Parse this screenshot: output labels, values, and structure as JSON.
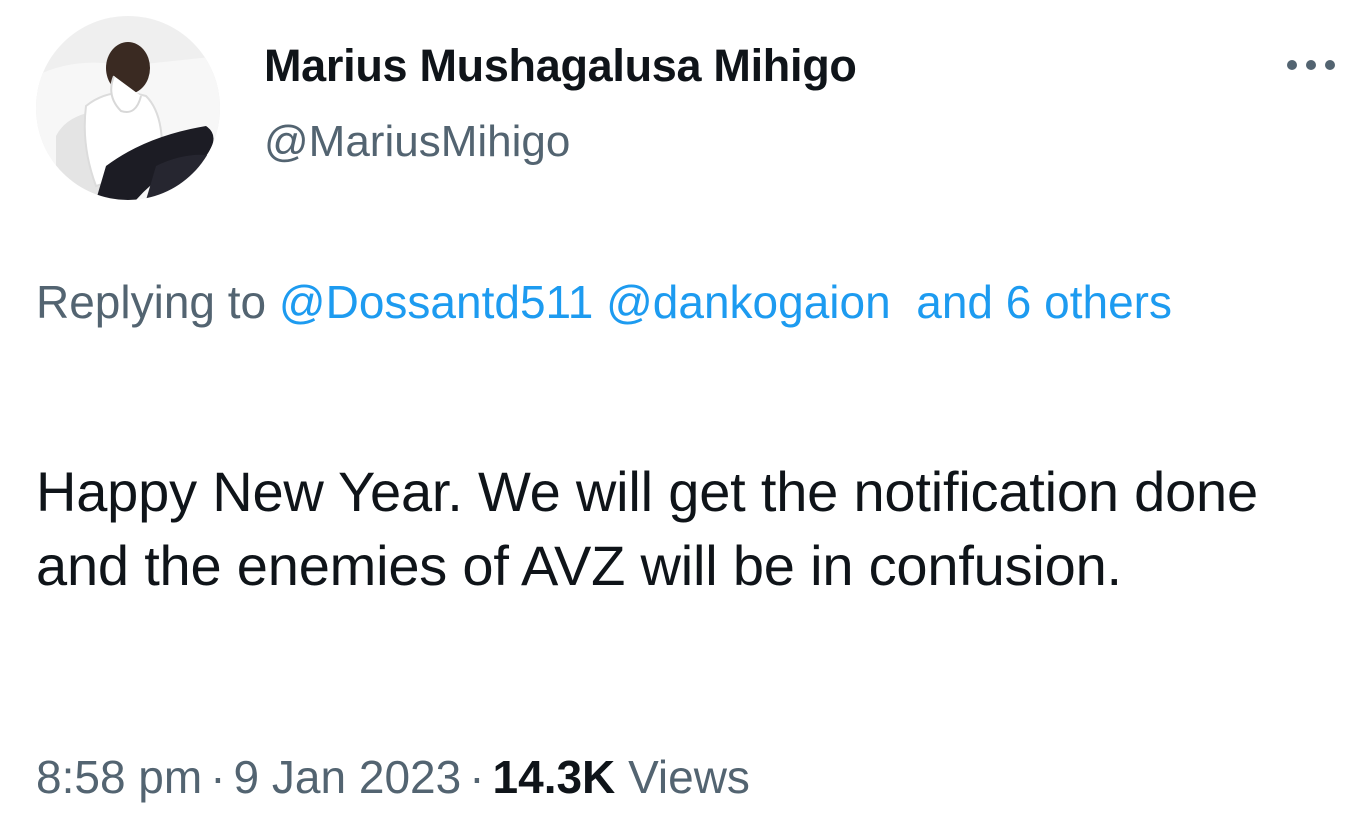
{
  "author": {
    "display_name": "Marius Mushagalusa Mihigo",
    "handle": "@MariusMihigo",
    "avatar_icon": "profile-photo"
  },
  "more_icon": "more-horizontal-icon",
  "reply_context": {
    "prefix": "Replying to",
    "mentions": [
      "@Dossantd511",
      "@dankogaion"
    ],
    "others": "and 6 others"
  },
  "text": "Happy New Year. We will get the notification done and the enemies of AVZ will be in confusion.",
  "meta": {
    "time": "8:58 pm",
    "separator": "·",
    "date": "9 Jan 2023",
    "views_count": "14.3K",
    "views_label": "Views"
  },
  "colors": {
    "link": "#1d9bf0",
    "secondary_text": "#536471",
    "primary_text": "#0f1419"
  }
}
